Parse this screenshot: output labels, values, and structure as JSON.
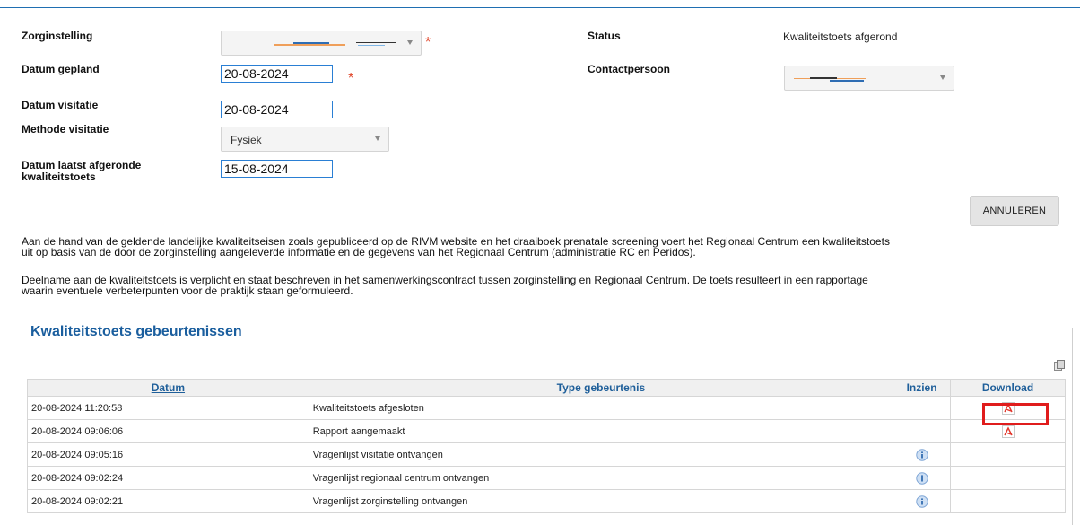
{
  "form": {
    "zorginstelling_label": "Zorginstelling",
    "datum_gepland_label": "Datum gepland",
    "datum_gepland_value": "20-08-2024",
    "datum_visitatie_label": "Datum visitatie",
    "datum_visitatie_value": "20-08-2024",
    "methode_label": "Methode visitatie",
    "methode_value": "Fysiek",
    "laatst_label_line1": "Datum laatst afgeronde",
    "laatst_label_line2": "kwaliteitstoets",
    "laatst_value": "15-08-2024",
    "status_label": "Status",
    "status_value": "Kwaliteitstoets afgerond",
    "contact_label": "Contactpersoon",
    "required_mark": "*"
  },
  "buttons": {
    "annuleren": "ANNULEREN"
  },
  "info": {
    "para1_line1": "Aan de hand van de geldende landelijke kwaliteitseisen zoals gepubliceerd op de RIVM website en het draaiboek prenatale screening voert het Regionaal Centrum een kwaliteitstoets",
    "para1_line2": "uit op basis van de door de zorginstelling aangeleverde informatie en de gegevens van het Regionaal Centrum (administratie RC en Peridos).",
    "para2_line1": "Deelname aan de kwaliteitstoets is verplicht en staat beschreven in het samenwerkingscontract tussen zorginstelling en Regionaal Centrum. De toets resulteert in een rapportage",
    "para2_line2": "waarin eventuele verbeterpunten voor de praktijk staan geformuleerd."
  },
  "events": {
    "title": "Kwaliteitstoets gebeurtenissen",
    "columns": {
      "datum": "Datum",
      "type": "Type gebeurtenis",
      "inzien": "Inzien",
      "download": "Download"
    },
    "rows": [
      {
        "datum": "20-08-2024 11:20:58",
        "type": "Kwaliteitstoets afgesloten",
        "inzien": "",
        "download": "pdf-icon"
      },
      {
        "datum": "20-08-2024 09:06:06",
        "type": "Rapport aangemaakt",
        "inzien": "",
        "download": "pdf-icon"
      },
      {
        "datum": "20-08-2024 09:05:16",
        "type": "Vragenlijst visitatie ontvangen",
        "inzien": "info-icon",
        "download": ""
      },
      {
        "datum": "20-08-2024 09:02:24",
        "type": "Vragenlijst regionaal centrum ontvangen",
        "inzien": "info-icon",
        "download": ""
      },
      {
        "datum": "20-08-2024 09:02:21",
        "type": "Vragenlijst zorginstelling ontvangen",
        "inzien": "info-icon",
        "download": ""
      }
    ]
  },
  "colors": {
    "accent": "#1a5e9e",
    "required": "#e0462b",
    "highlight": "#e01c1c",
    "input_border": "#2a7fd4"
  }
}
